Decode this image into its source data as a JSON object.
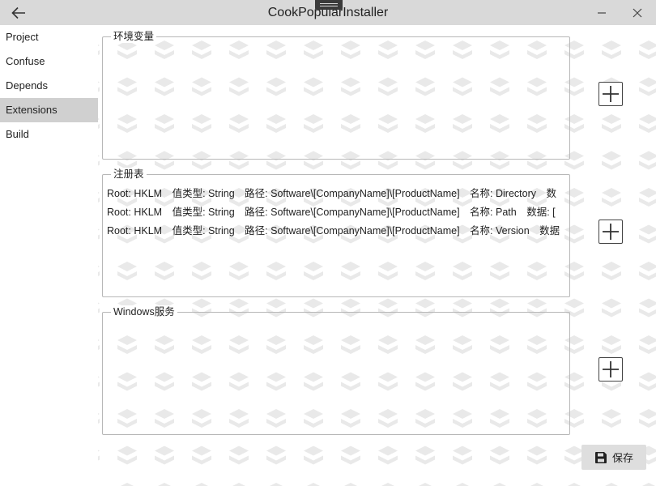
{
  "window": {
    "title": "CookPopularInstaller",
    "icons": {
      "back": "arrow-left-icon",
      "minimize": "minimize-icon",
      "close": "close-icon",
      "grip": "drag-grip-icon"
    }
  },
  "sidebar": {
    "items": [
      {
        "label": "Project"
      },
      {
        "label": "Confuse"
      },
      {
        "label": "Depends"
      },
      {
        "label": "Extensions",
        "active": true
      },
      {
        "label": "Build"
      }
    ]
  },
  "sections": {
    "env": {
      "title": "环境变量"
    },
    "registry": {
      "title": "注册表",
      "rows": [
        {
          "root": "Root:  HKLM",
          "type": "值类型:  String",
          "path": "路径:  Software\\[CompanyName]\\[ProductName]",
          "name": "名称:  Directory",
          "extra": "数"
        },
        {
          "root": "Root:  HKLM",
          "type": "值类型:  String",
          "path": "路径:  Software\\[CompanyName]\\[ProductName]",
          "name": "名称:  Path",
          "extra": "数据:  ["
        },
        {
          "root": "Root:  HKLM",
          "type": "值类型:  String",
          "path": "路径:  Software\\[CompanyName]\\[ProductName]",
          "name": "名称:  Version",
          "extra": "数据"
        }
      ]
    },
    "services": {
      "title": "Windows服务"
    }
  },
  "buttons": {
    "add_icon": "plus-icon",
    "save": {
      "label": "保存",
      "icon": "save-icon"
    }
  },
  "colors": {
    "titlebar": "#d9d9d9",
    "nav_active": "#d0d0d0",
    "pattern": "#e9e9e9",
    "border": "#b7b7b7"
  }
}
